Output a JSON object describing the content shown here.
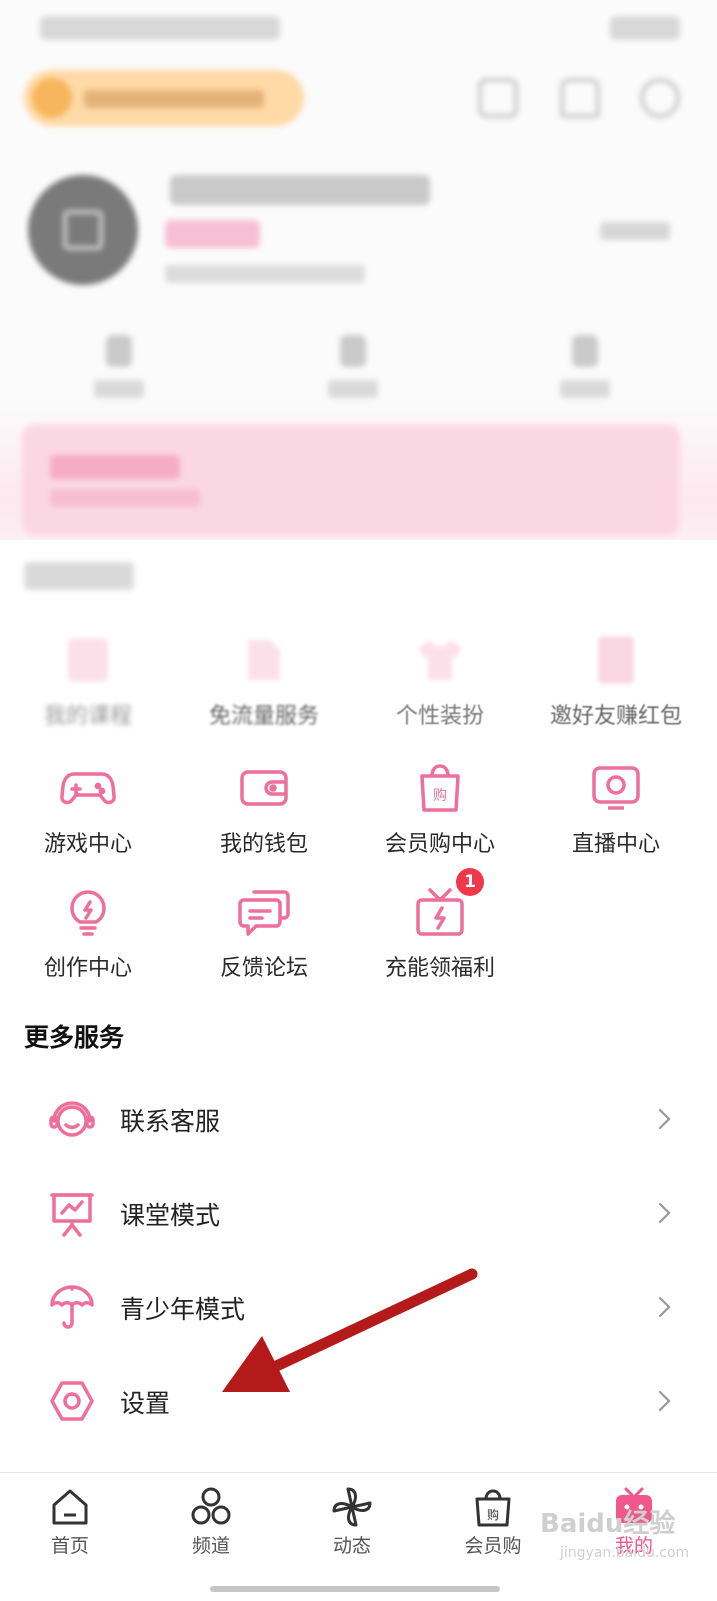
{
  "recommended_services": {
    "items": [
      {
        "label": "我的课程",
        "icon": "course-icon"
      },
      {
        "label": "免流量服务",
        "icon": "sim-card-icon"
      },
      {
        "label": "个性装扮",
        "icon": "tshirt-icon"
      },
      {
        "label": "邀好友赚红包",
        "icon": "red-packet-icon"
      },
      {
        "label": "游戏中心",
        "icon": "gamepad-icon"
      },
      {
        "label": "我的钱包",
        "icon": "wallet-icon"
      },
      {
        "label": "会员购中心",
        "icon": "shopping-bag-icon"
      },
      {
        "label": "直播中心",
        "icon": "tv-icon"
      },
      {
        "label": "创作中心",
        "icon": "lightbulb-icon"
      },
      {
        "label": "反馈论坛",
        "icon": "chat-bubbles-icon"
      },
      {
        "label": "充能领福利",
        "icon": "gift-icon",
        "badge": "1"
      }
    ]
  },
  "more_services": {
    "title": "更多服务",
    "items": [
      {
        "label": "联系客服",
        "icon": "headset-icon"
      },
      {
        "label": "课堂模式",
        "icon": "classroom-board-icon"
      },
      {
        "label": "青少年模式",
        "icon": "umbrella-icon"
      },
      {
        "label": "设置",
        "icon": "settings-hexagon-icon"
      }
    ]
  },
  "tabbar": {
    "tabs": [
      {
        "label": "首页",
        "icon": "home-icon"
      },
      {
        "label": "频道",
        "icon": "channels-icon"
      },
      {
        "label": "动态",
        "icon": "pinwheel-icon"
      },
      {
        "label": "会员购",
        "icon": "shopping-bag-icon"
      },
      {
        "label": "我的",
        "icon": "tv-face-icon",
        "active": true
      }
    ]
  },
  "watermark": {
    "text": "Baidu经验",
    "sub": "jingyan.baidu.com"
  },
  "colors": {
    "accent": "#f0578a",
    "icon_pink": "#ee6f99",
    "badge_red": "#f0384a",
    "arrow_red": "#b51a1a"
  }
}
